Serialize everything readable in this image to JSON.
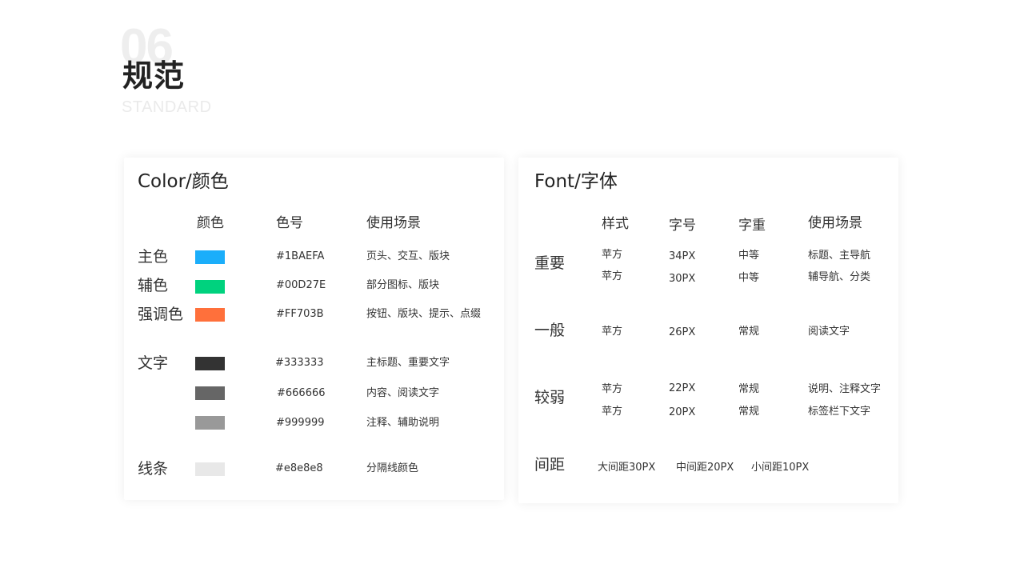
{
  "header": {
    "number": "06",
    "title": "规范",
    "subtitle": "STANDARD"
  },
  "color_card": {
    "title": "Color/颜色",
    "headers": {
      "color": "颜色",
      "code": "色号",
      "usage": "使用场景"
    },
    "groups": {
      "main": "主色",
      "secondary": "辅色",
      "accent": "强调色",
      "text": "文字",
      "line": "线条"
    },
    "rows": [
      {
        "color": "#1BAEFA",
        "code": "#1BAEFA",
        "usage": "页头、交互、版块"
      },
      {
        "color": "#00D27E",
        "code": "#00D27E",
        "usage": "部分图标、版块"
      },
      {
        "color": "#FF703B",
        "code": "#FF703B",
        "usage": "按钮、版块、提示、点缀"
      },
      {
        "color": "#333333",
        "code": "#333333",
        "usage": "主标题、重要文字"
      },
      {
        "color": "#666666",
        "code": "#666666",
        "usage": "内容、阅读文字"
      },
      {
        "color": "#999999",
        "code": "#999999",
        "usage": "注释、辅助说明"
      },
      {
        "color": "#e8e8e8",
        "code": "#e8e8e8",
        "usage": "分隔线颜色"
      }
    ]
  },
  "font_card": {
    "title": "Font/字体",
    "headers": {
      "style": "样式",
      "size": "字号",
      "weight": "字重",
      "usage": "使用场景"
    },
    "groups": {
      "important": "重要",
      "normal": "一般",
      "weak": "较弱",
      "spacing": "间距"
    },
    "rows": [
      {
        "style": "苹方",
        "size": "34PX",
        "weight": "中等",
        "usage": "标题、主导航"
      },
      {
        "style": "苹方",
        "size": "30PX",
        "weight": "中等",
        "usage": "辅导航、分类"
      },
      {
        "style": "苹方",
        "size": "26PX",
        "weight": "常规",
        "usage": "阅读文字"
      },
      {
        "style": "苹方",
        "size": "22PX",
        "weight": "常规",
        "usage": "说明、注释文字"
      },
      {
        "style": "苹方",
        "size": "20PX",
        "weight": "常规",
        "usage": "标签栏下文字"
      }
    ],
    "spacing": {
      "large": "大间距30PX",
      "medium": "中间距20PX",
      "small": "小间距10PX"
    }
  }
}
